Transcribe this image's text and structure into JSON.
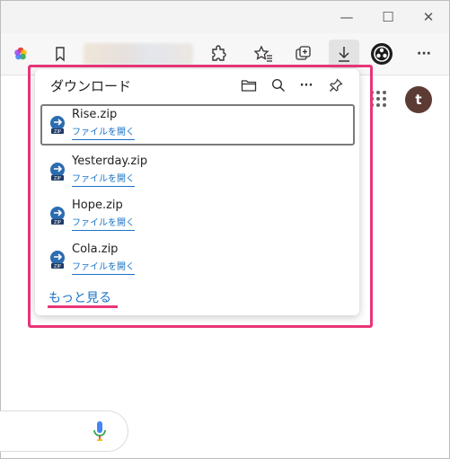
{
  "window": {
    "minimize_glyph": "—",
    "maximize_glyph": "☐",
    "close_glyph": "✕"
  },
  "toolbar": {
    "icons": [
      "color-wheel-icon",
      "bookmark-icon",
      "extensions-puzzle-icon",
      "favorites-star-icon",
      "collections-icon",
      "download-arrow-icon",
      "profile-emblem-icon",
      "more-menu-icon"
    ],
    "more_glyph": "···"
  },
  "profile": {
    "avatar_letter": "t",
    "avatar_color": "#5d3b35"
  },
  "downloads": {
    "title": "ダウンロード",
    "more_glyph": "···",
    "items": [
      {
        "filename": "Rise.zip",
        "action": "ファイルを開く",
        "selected": true
      },
      {
        "filename": "Yesterday.zip",
        "action": "ファイルを開く",
        "selected": false
      },
      {
        "filename": "Hope.zip",
        "action": "ファイルを開く",
        "selected": false
      },
      {
        "filename": "Cola.zip",
        "action": "ファイルを開く",
        "selected": false
      }
    ],
    "see_more": "もっと見る"
  },
  "colors": {
    "highlight": "#e9357a",
    "link": "#1a73c7"
  }
}
